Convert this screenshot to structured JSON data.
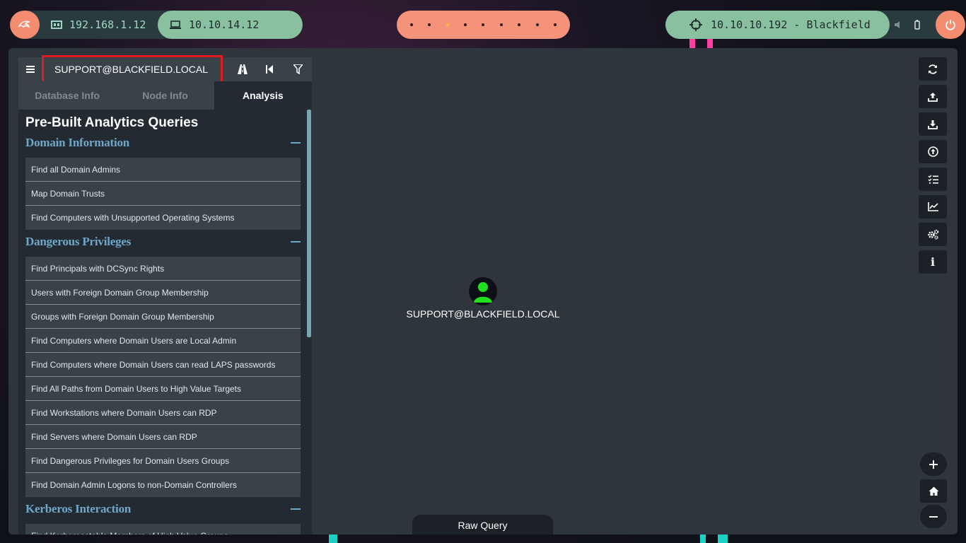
{
  "topbar": {
    "local_ip": "192.168.1.12",
    "vpn_ip": "10.10.14.12",
    "target": "10.10.10.192 - Blackfield",
    "workspaces": [
      {
        "active": false
      },
      {
        "active": false
      },
      {
        "active": true
      },
      {
        "active": false
      },
      {
        "active": false
      },
      {
        "active": false
      },
      {
        "active": false
      },
      {
        "active": false
      },
      {
        "active": false
      }
    ]
  },
  "search": {
    "value": "SUPPORT@BLACKFIELD.LOCAL"
  },
  "tabs": [
    {
      "label": "Database Info"
    },
    {
      "label": "Node Info"
    },
    {
      "label": "Analysis"
    }
  ],
  "analysis": {
    "title": "Pre-Built Analytics Queries",
    "sections": [
      {
        "title": "Domain Information",
        "queries": [
          "Find all Domain Admins",
          "Map Domain Trusts",
          "Find Computers with Unsupported Operating Systems"
        ]
      },
      {
        "title": "Dangerous Privileges",
        "queries": [
          "Find Principals with DCSync Rights",
          "Users with Foreign Domain Group Membership",
          "Groups with Foreign Domain Group Membership",
          "Find Computers where Domain Users are Local Admin",
          "Find Computers where Domain Users can read LAPS passwords",
          "Find All Paths from Domain Users to High Value Targets",
          "Find Workstations where Domain Users can RDP",
          "Find Servers where Domain Users can RDP",
          "Find Dangerous Privileges for Domain Users Groups",
          "Find Domain Admin Logons to non-Domain Controllers"
        ]
      },
      {
        "title": "Kerberos Interaction",
        "queries": [
          "Find Kerberoastable Members of High Value Groups"
        ]
      }
    ]
  },
  "graph": {
    "node_label": "SUPPORT@BLACKFIELD.LOCAL",
    "node_color": "#20e020"
  },
  "raw_query_label": "Raw Query",
  "right_toolbar": {
    "items": [
      "refresh-icon",
      "upload-icon",
      "download-icon",
      "upload-circle-icon",
      "checklist-icon",
      "chart-icon",
      "gears-icon",
      "info-icon"
    ],
    "info_label": "i"
  },
  "zoom_controls": [
    "zoom-in-icon",
    "home-icon",
    "zoom-out-icon"
  ],
  "colors": {
    "accent_salmon": "#f48c6f",
    "accent_green": "#88c0a0",
    "section_title": "#6fa7c9",
    "highlight_box": "#e01b24"
  }
}
